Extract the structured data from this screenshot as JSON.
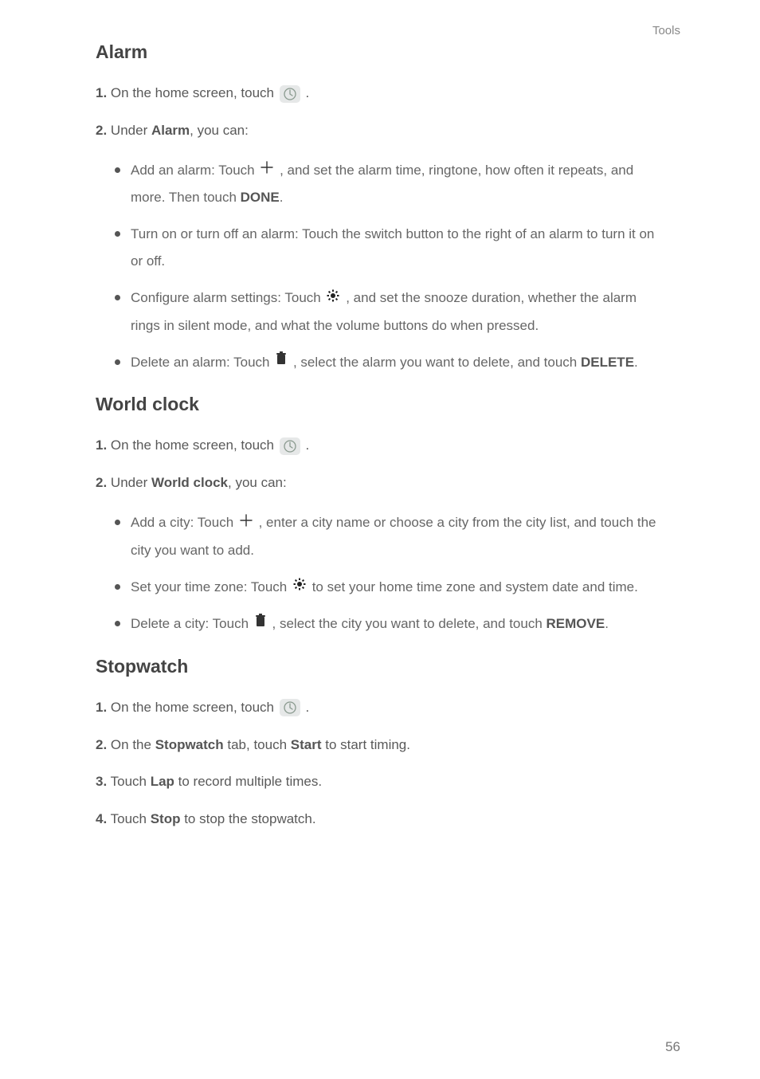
{
  "header": {
    "category": "Tools"
  },
  "sections": {
    "alarm": {
      "heading": "Alarm",
      "step1_prefix": "1.",
      "step1_text_a": "On the home screen, touch ",
      "step1_text_b": " .",
      "step2_prefix": "2.",
      "step2_text_a": "Under ",
      "step2_bold": "Alarm",
      "step2_text_b": ", you can:",
      "bullets": {
        "b1_a": "Add an alarm: Touch ",
        "b1_b": " , and set the alarm time, ringtone, how often it repeats, and more. Then touch ",
        "b1_bold": "DONE",
        "b1_c": ".",
        "b2": "Turn on or turn off an alarm: Touch the switch button to the right of an alarm to turn it on or off.",
        "b3_a": "Configure alarm settings: Touch ",
        "b3_b": " , and set the snooze duration, whether the alarm rings in silent mode, and what the volume buttons do when pressed.",
        "b4_a": "Delete an alarm: Touch ",
        "b4_b": " , select the alarm you want to delete, and touch ",
        "b4_bold": "DELETE",
        "b4_c": "."
      }
    },
    "worldclock": {
      "heading": "World  clock",
      "step1_prefix": "1.",
      "step1_text_a": "On the home screen, touch ",
      "step1_text_b": " .",
      "step2_prefix": "2.",
      "step2_text_a": "Under ",
      "step2_bold": "World clock",
      "step2_text_b": ", you can:",
      "bullets": {
        "b1_a": "Add a city: Touch ",
        "b1_b": " , enter a city name or choose a city from the city list, and touch the city you want to add.",
        "b2_a": "Set your time zone: Touch ",
        "b2_b": " to set your home time zone and system date and time.",
        "b3_a": "Delete a city: Touch ",
        "b3_b": " , select the city you want to delete, and touch ",
        "b3_bold": "REMOVE",
        "b3_c": "."
      }
    },
    "stopwatch": {
      "heading": "Stopwatch",
      "step1_prefix": "1.",
      "step1_text_a": "On the home screen, touch ",
      "step1_text_b": " .",
      "step2_prefix": "2.",
      "step2_text_a": "On the ",
      "step2_bold1": "Stopwatch",
      "step2_text_b": " tab, touch ",
      "step2_bold2": "Start",
      "step2_text_c": " to start timing.",
      "step3_prefix": "3.",
      "step3_text_a": "Touch ",
      "step3_bold": "Lap",
      "step3_text_b": " to record multiple times.",
      "step4_prefix": "4.",
      "step4_text_a": "Touch ",
      "step4_bold": "Stop",
      "step4_text_b": " to stop the stopwatch."
    }
  },
  "page_number": "56"
}
